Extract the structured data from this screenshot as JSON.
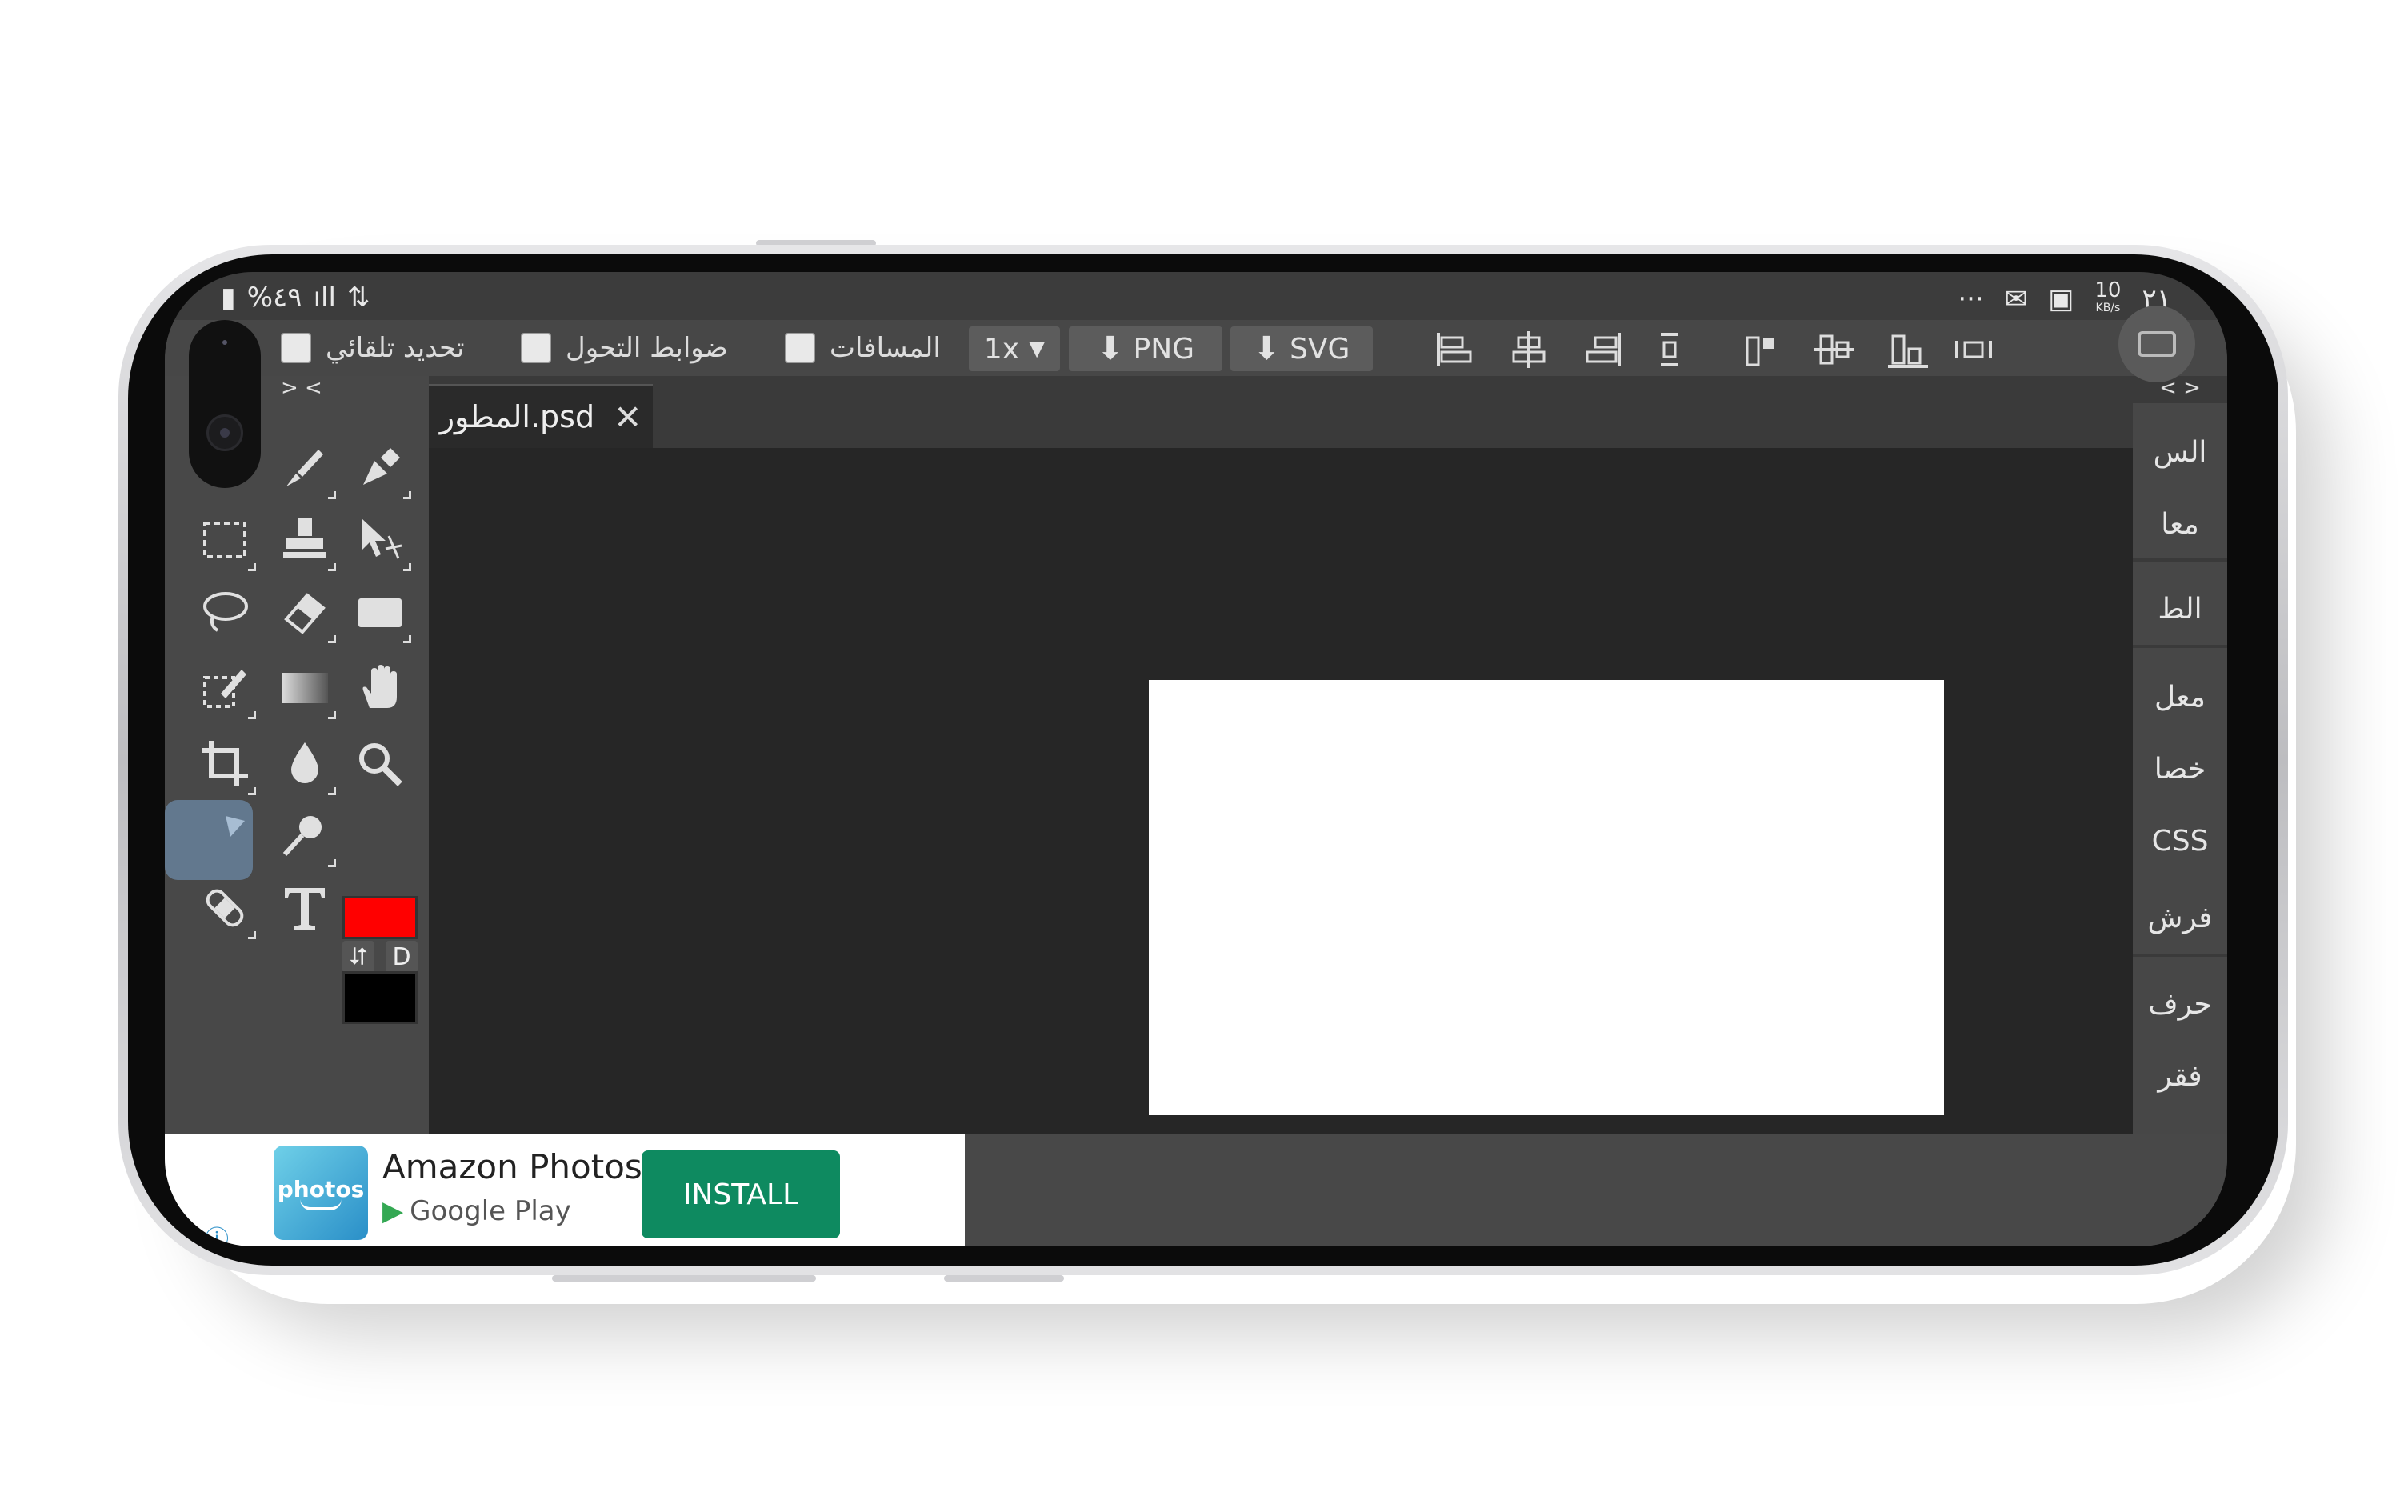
{
  "status_bar": {
    "battery": "%٤٩",
    "signal": "",
    "net_speed_value": "10",
    "net_speed_unit": "KB/s",
    "time": "٢١"
  },
  "top_bar": {
    "auto_select_label": "تحديد تلقائي",
    "transform_controls_label": "ضوابط التحول",
    "distances_label": "المسافات",
    "scale_value": "1x",
    "png_label": "PNG",
    "svg_label": "SVG"
  },
  "tab": {
    "filename": "المطور.psd",
    "close": "✕"
  },
  "chevrons": {
    "left": "> <",
    "right": "< >"
  },
  "right_panel": {
    "items": [
      "الس",
      "معا",
      "الط",
      "معل",
      "خصا",
      "CSS",
      "فرش",
      "حرف",
      "فقر"
    ]
  },
  "swatches": {
    "foreground": "#ff0000",
    "background": "#000000",
    "swap": "⮃",
    "default": "D"
  },
  "ad": {
    "logo_text": "photos",
    "title": "Amazon Photos",
    "store": "Google Play",
    "install": "INSTALL",
    "info": "ⓘ"
  }
}
